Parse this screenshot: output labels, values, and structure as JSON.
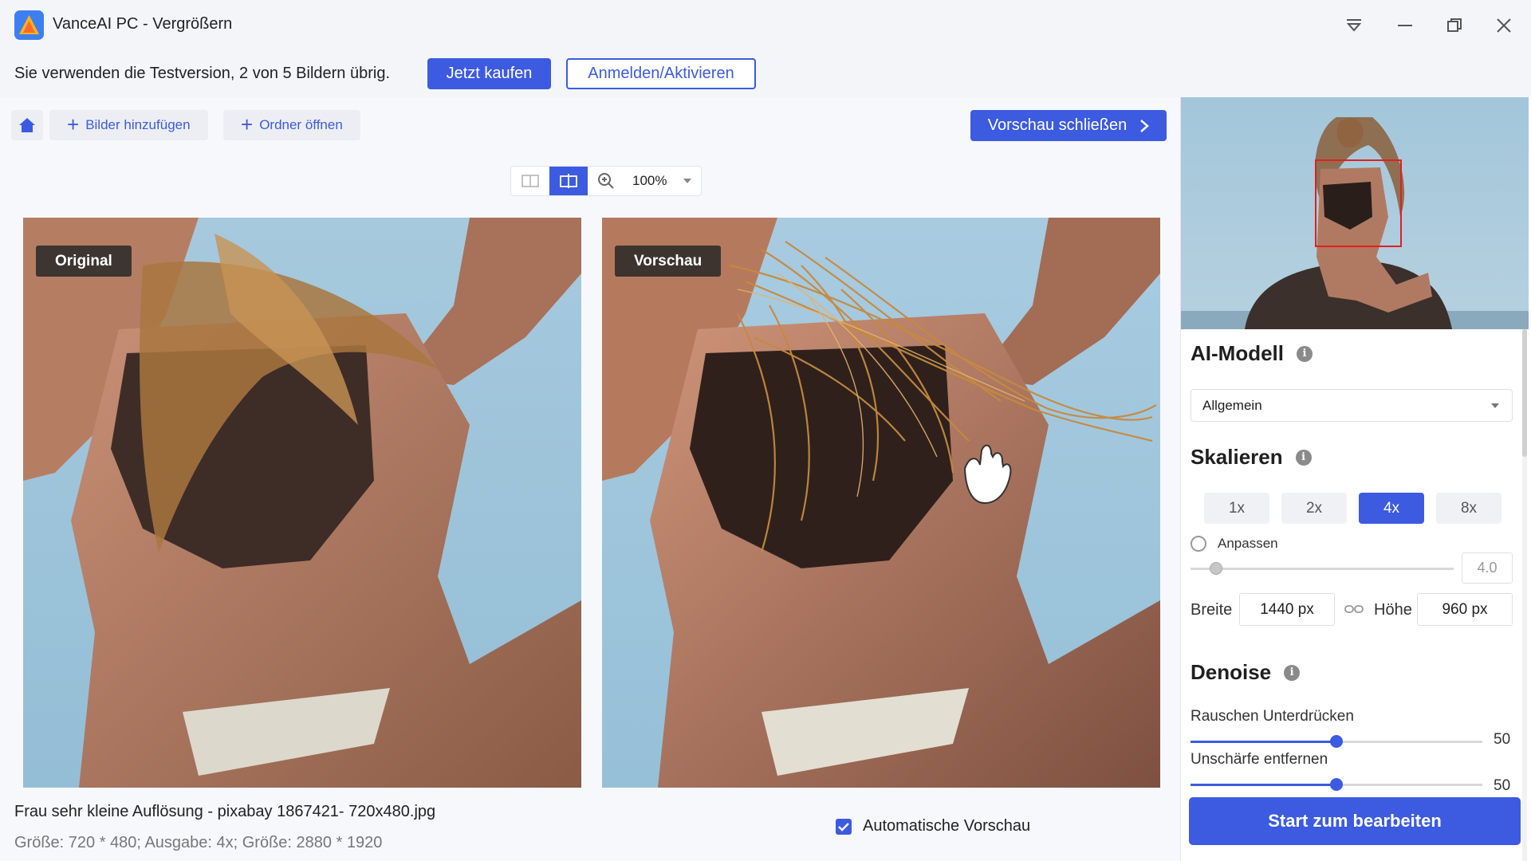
{
  "window": {
    "title": "VanceAI PC - Vergrößern",
    "icons": [
      "app-logo",
      "dropdown-menu-icon",
      "minimize-icon",
      "restore-icon",
      "close-icon"
    ]
  },
  "trial": {
    "message": "Sie verwenden die Testversion, 2 von 5 Bildern übrig.",
    "buy_label": "Jetzt kaufen",
    "login_label": "Anmelden/Aktivieren"
  },
  "toolbar": {
    "add_images_label": "Bilder hinzufügen",
    "open_folder_label": "Ordner öffnen",
    "close_preview_label": "Vorschau schließen"
  },
  "view": {
    "zoom": "100%"
  },
  "images": {
    "original_tag": "Original",
    "preview_tag": "Vorschau"
  },
  "file": {
    "name": "Frau sehr kleine Auflösung - pixabay 1867421- 720x480.jpg",
    "info": "Größe: 720 * 480; Ausgabe: 4x; Größe: 2880 * 1920"
  },
  "auto_preview": {
    "label": "Automatische Vorschau",
    "checked": true
  },
  "panel": {
    "ai_model": {
      "title": "AI-Modell",
      "selected": "Allgemein"
    },
    "scale": {
      "title": "Skalieren",
      "options": [
        "1x",
        "2x",
        "4x",
        "8x"
      ],
      "active": "4x",
      "custom_label": "Anpassen",
      "custom_value": "4.0",
      "width_label": "Breite",
      "width_value": "1440 px",
      "height_label": "Höhe",
      "height_value": "960 px"
    },
    "denoise": {
      "title": "Denoise",
      "noise_label": "Rauschen Unterdrücken",
      "noise_value": "50",
      "blur_label": "Unschärfe entfernen",
      "blur_value": "50"
    },
    "start_label": "Start zum bearbeiten"
  },
  "colors": {
    "accent": "#3c5be0",
    "background": "#f7f8fb"
  }
}
